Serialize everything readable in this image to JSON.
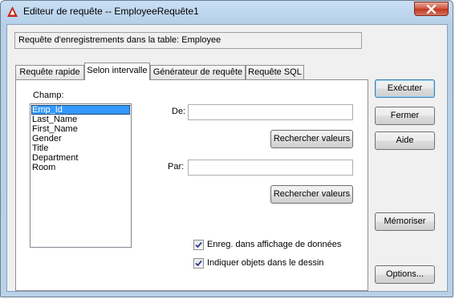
{
  "window": {
    "title": "Editeur de requête -- EmployeeRequête1"
  },
  "info": {
    "text": "Requête d'enregistrements dans la table:  Employee"
  },
  "tabs": [
    {
      "label": "Requête rapide"
    },
    {
      "label": "Selon intervalle"
    },
    {
      "label": "Générateur de requête"
    },
    {
      "label": "Requête SQL"
    }
  ],
  "panel": {
    "field_label": "Champ:",
    "fields": [
      "Emp_Id",
      "Last_Name",
      "First_Name",
      "Gender",
      "Title",
      "Department",
      "Room"
    ],
    "selected_field": "Emp_Id",
    "from_label": "De:",
    "from_value": "",
    "to_label": "Par:",
    "to_value": "",
    "search_values_label": "Rechercher valeurs",
    "checkbox_save_label": "Enreg. dans affichage de données",
    "checkbox_save_checked": true,
    "checkbox_show_label": "Indiquer objets dans le dessin",
    "checkbox_show_checked": true
  },
  "buttons": {
    "execute": "Exécuter",
    "close": "Fermer",
    "help": "Aide",
    "save": "Mémoriser",
    "options": "Options..."
  }
}
